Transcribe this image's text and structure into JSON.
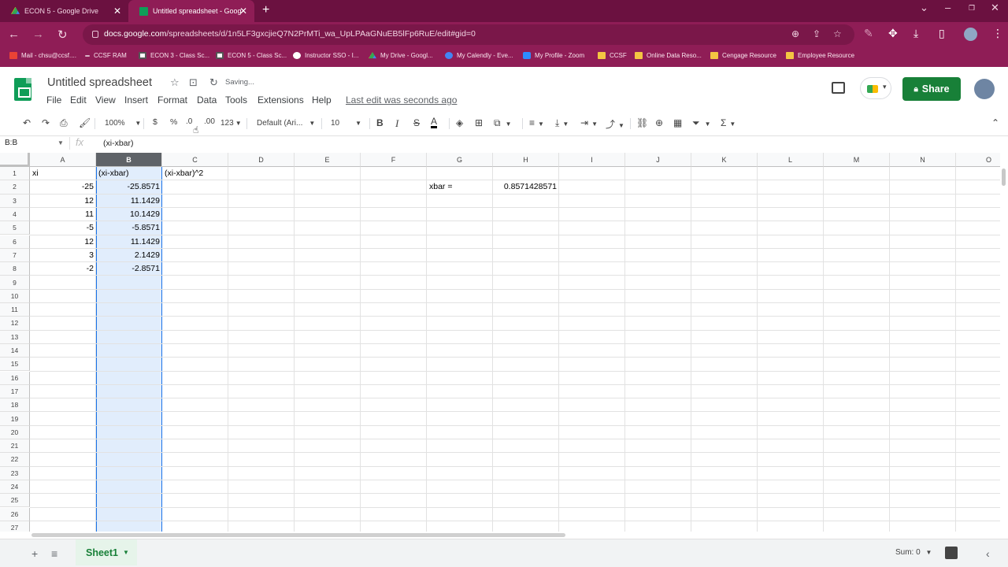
{
  "browser": {
    "tabs": [
      {
        "title": "ECON 5 - Google Drive",
        "active": false
      },
      {
        "title": "Untitled spreadsheet - Google",
        "active": true
      }
    ],
    "url_host": "docs.google.com",
    "url_path": "/spreadsheets/d/1n5LF3gxcjieQ7N2PrMTi_wa_UpLPAaGNuEB5lFp6RuE/edit#gid=0",
    "bookmarks": [
      "Mail - chsu@ccsf....",
      "CCSF RAM",
      "ECON 3 - Class Sc...",
      "ECON 5 - Class Sc...",
      "Instructor SSO - I...",
      "My Drive - Googl...",
      "My Calendly - Eve...",
      "My Profile - Zoom",
      "CCSF",
      "Online Data Reso...",
      "Cengage Resource",
      "Employee Resource"
    ]
  },
  "header": {
    "title": "Untitled spreadsheet",
    "saving": "Saving...",
    "menus": [
      "File",
      "Edit",
      "View",
      "Insert",
      "Format",
      "Data",
      "Tools",
      "Extensions",
      "Help"
    ],
    "last_edit": "Last edit was seconds ago",
    "share": "Share"
  },
  "toolbar": {
    "zoom": "100%",
    "currency": "$",
    "percent": "%",
    "dec_decrease": ".0",
    "dec_increase": ".00",
    "format_more": "123",
    "font": "Default (Ari...",
    "font_size": "10",
    "bold": "B",
    "italic": "I",
    "strike": "S",
    "textcolor": "A"
  },
  "formula_bar": {
    "name_box": "B:B",
    "fx": "fx",
    "content": "(xi-xbar)"
  },
  "grid": {
    "columns": [
      "A",
      "B",
      "C",
      "D",
      "E",
      "F",
      "G",
      "H",
      "I",
      "J",
      "K",
      "L",
      "M",
      "N",
      "O"
    ],
    "selected_column": "B",
    "rows": [
      "1",
      "2",
      "3",
      "4",
      "5",
      "6",
      "7",
      "8",
      "9",
      "10",
      "11",
      "12",
      "13",
      "14",
      "15",
      "16",
      "17",
      "18",
      "19",
      "20",
      "21",
      "22",
      "23",
      "24",
      "25",
      "26",
      "27"
    ],
    "cells": {
      "A1": "xi",
      "B1": "(xi-xbar)",
      "C1": "(xi-xbar)^2",
      "A2": "-25",
      "B2": "-25.8571",
      "G2": "xbar =",
      "H2": "0.8571428571",
      "A3": "12",
      "B3": "11.1429",
      "A4": "11",
      "B4": "10.1429",
      "A5": "-5",
      "B5": "-5.8571",
      "A6": "12",
      "B6": "11.1429",
      "A7": "3",
      "B7": "2.1429",
      "A8": "-2",
      "B8": "-2.8571"
    }
  },
  "bottom": {
    "sheet_name": "Sheet1",
    "sum": "Sum: 0"
  },
  "colors": {
    "chrome_dark": "#6b1140",
    "chrome": "#8f1d56",
    "share_green": "#188038",
    "selection_blue": "#1a73e8"
  }
}
